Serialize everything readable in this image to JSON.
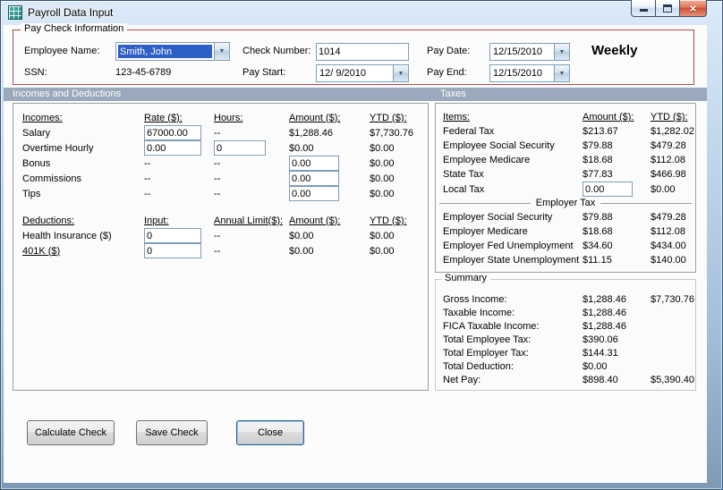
{
  "window": {
    "title": "Payroll Data Input",
    "frequency_label": "Weekly"
  },
  "icons": {
    "dropdown_glyph": "▼",
    "close_glyph": "×"
  },
  "pay_check_info": {
    "legend": "Pay Check Information",
    "employee_name_label": "Employee Name:",
    "employee_name_value": "Smith, John",
    "ssn_label": "SSN:",
    "ssn_value": "123-45-6789",
    "check_number_label": "Check Number:",
    "check_number_value": "1014",
    "pay_start_label": "Pay Start:",
    "pay_start_value": "12/ 9/2010",
    "pay_date_label": "Pay Date:",
    "pay_date_value": "12/15/2010",
    "pay_end_label": "Pay End:",
    "pay_end_value": "12/15/2010"
  },
  "section_band": {
    "incomes_and_deductions": "Incomes and Deductions",
    "taxes": "Taxes"
  },
  "incomes": {
    "headers": {
      "name": "Incomes:",
      "rate": "Rate ($):",
      "hours": "Hours:",
      "amount": "Amount ($):",
      "ytd": "YTD ($):"
    },
    "rows": [
      {
        "label": "Salary",
        "rate": "67000.00",
        "hours": "--",
        "amount": "$1,288.46",
        "ytd": "$7,730.76"
      },
      {
        "label": "Overtime Hourly",
        "rate": "0.00",
        "hours": "0",
        "amount": "$0.00",
        "ytd": "$0.00"
      },
      {
        "label": "Bonus",
        "rate": "--",
        "hours": "--",
        "amount": "0.00",
        "ytd": "$0.00"
      },
      {
        "label": "Commissions",
        "rate": "--",
        "hours": "--",
        "amount": "0.00",
        "ytd": "$0.00"
      },
      {
        "label": "Tips",
        "rate": "--",
        "hours": "--",
        "amount": "0.00",
        "ytd": "$0.00"
      }
    ]
  },
  "deductions": {
    "headers": {
      "name": "Deductions:",
      "input": "Input:",
      "annual_limit": "Annual Limit($):",
      "amount": "Amount ($):",
      "ytd": "YTD ($):"
    },
    "rows": [
      {
        "label": "Health Insurance  ($)",
        "input": "0",
        "annual_limit": "--",
        "amount": "$0.00",
        "ytd": "$0.00"
      },
      {
        "label": "401K  ($)",
        "input": "0",
        "annual_limit": "--",
        "amount": "$0.00",
        "ytd": "$0.00"
      }
    ]
  },
  "taxes": {
    "headers": {
      "items": "Items:",
      "amount": "Amount ($):",
      "ytd": "YTD ($):"
    },
    "employee_rows": [
      {
        "label": "Federal Tax",
        "amount": "$213.67",
        "ytd": "$1,282.02"
      },
      {
        "label": "Employee Social Security",
        "amount": "$79.88",
        "ytd": "$479.28"
      },
      {
        "label": "Employee Medicare",
        "amount": "$18.68",
        "ytd": "$112.08"
      },
      {
        "label": "State Tax",
        "amount": "$77.83",
        "ytd": "$466.98"
      },
      {
        "label": "Local Tax",
        "amount": "0.00",
        "ytd": "$0.00"
      }
    ],
    "employer_section_label": "Employer Tax",
    "employer_rows": [
      {
        "label": "Employer Social Security",
        "amount": "$79.88",
        "ytd": "$479.28"
      },
      {
        "label": "Employer Medicare",
        "amount": "$18.68",
        "ytd": "$112.08"
      },
      {
        "label": "Employer Fed Unemployment",
        "amount": "$34.60",
        "ytd": "$434.00"
      },
      {
        "label": "Employer State Unemployment",
        "amount": "$11.15",
        "ytd": "$140.00"
      }
    ]
  },
  "summary": {
    "legend": "Summary",
    "rows": [
      {
        "label": "Gross Income:",
        "amount": "$1,288.46",
        "ytd": "$7,730.76"
      },
      {
        "label": "Taxable Income:",
        "amount": "$1,288.46",
        "ytd": ""
      },
      {
        "label": "FICA Taxable Income:",
        "amount": "$1,288.46",
        "ytd": ""
      },
      {
        "label": "Total Employee Tax:",
        "amount": "$390.06",
        "ytd": ""
      },
      {
        "label": "Total Employer Tax:",
        "amount": "$144.31",
        "ytd": ""
      },
      {
        "label": "Total Deduction:",
        "amount": "$0.00",
        "ytd": ""
      },
      {
        "label": "Net Pay:",
        "amount": "$898.40",
        "ytd": "$5,390.40"
      }
    ]
  },
  "buttons": {
    "calculate": "Calculate Check",
    "save": "Save Check",
    "close": "Close"
  },
  "colors": {
    "selection_blue": "#2e5fc6",
    "groupbox_red": "#ae4a44",
    "section_band": "#9aa9bb",
    "titlebar_close_red": "#c94f30"
  }
}
